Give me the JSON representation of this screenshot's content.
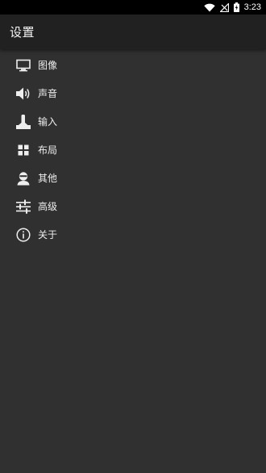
{
  "status_bar": {
    "time": "3:23",
    "icons": [
      "wifi-icon",
      "signal-icon",
      "battery-charging-icon"
    ]
  },
  "app_bar": {
    "title": "设置"
  },
  "menu": {
    "items": [
      {
        "label": "图像",
        "icon": "monitor-icon"
      },
      {
        "label": "声音",
        "icon": "speaker-icon"
      },
      {
        "label": "输入",
        "icon": "joystick-icon"
      },
      {
        "label": "布局",
        "icon": "grid-icon"
      },
      {
        "label": "其他",
        "icon": "person-icon"
      },
      {
        "label": "高级",
        "icon": "sliders-icon"
      },
      {
        "label": "关于",
        "icon": "info-icon"
      }
    ]
  },
  "colors": {
    "background": "#303030",
    "app_bar": "#212121",
    "status_bar": "#000000",
    "text": "#eeeeee"
  }
}
